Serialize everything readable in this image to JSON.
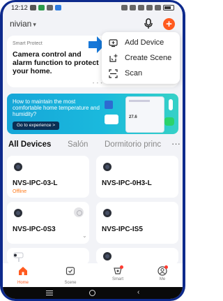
{
  "status": {
    "time": "12:12"
  },
  "header": {
    "home_name": "nivian",
    "caret": "▾"
  },
  "promo": {
    "small_title": "Smart Protect",
    "title": "Camera control and alarm function to protect your home.",
    "dots": "• • •"
  },
  "menu": {
    "items": [
      {
        "label": "Add Device",
        "icon": "add-device-icon"
      },
      {
        "label": "Create Scene",
        "icon": "create-scene-icon"
      },
      {
        "label": "Scan",
        "icon": "scan-icon"
      }
    ]
  },
  "banner": {
    "text": "How to maintain the most comfortable home temperature and humidity?",
    "button": "Go to experience >",
    "mock_temp": "27.6"
  },
  "tabs": {
    "items": [
      "All Devices",
      "Salón",
      "Dormitorio princ"
    ],
    "more": "···"
  },
  "devices": [
    {
      "name": "NVS-IPC-03-L",
      "status": "Offline"
    },
    {
      "name": "NVS-IPC-0H3-L",
      "status": ""
    },
    {
      "name": "NVS-IPC-0S3",
      "status": ""
    },
    {
      "name": "NVS-IPC-IS5",
      "status": ""
    }
  ],
  "tabbar": {
    "items": [
      "Home",
      "Scene",
      "Smart",
      "Me"
    ]
  },
  "colors": {
    "accent": "#ff5a1f",
    "arrow": "#1677d8",
    "banner": "#17a6d8"
  }
}
